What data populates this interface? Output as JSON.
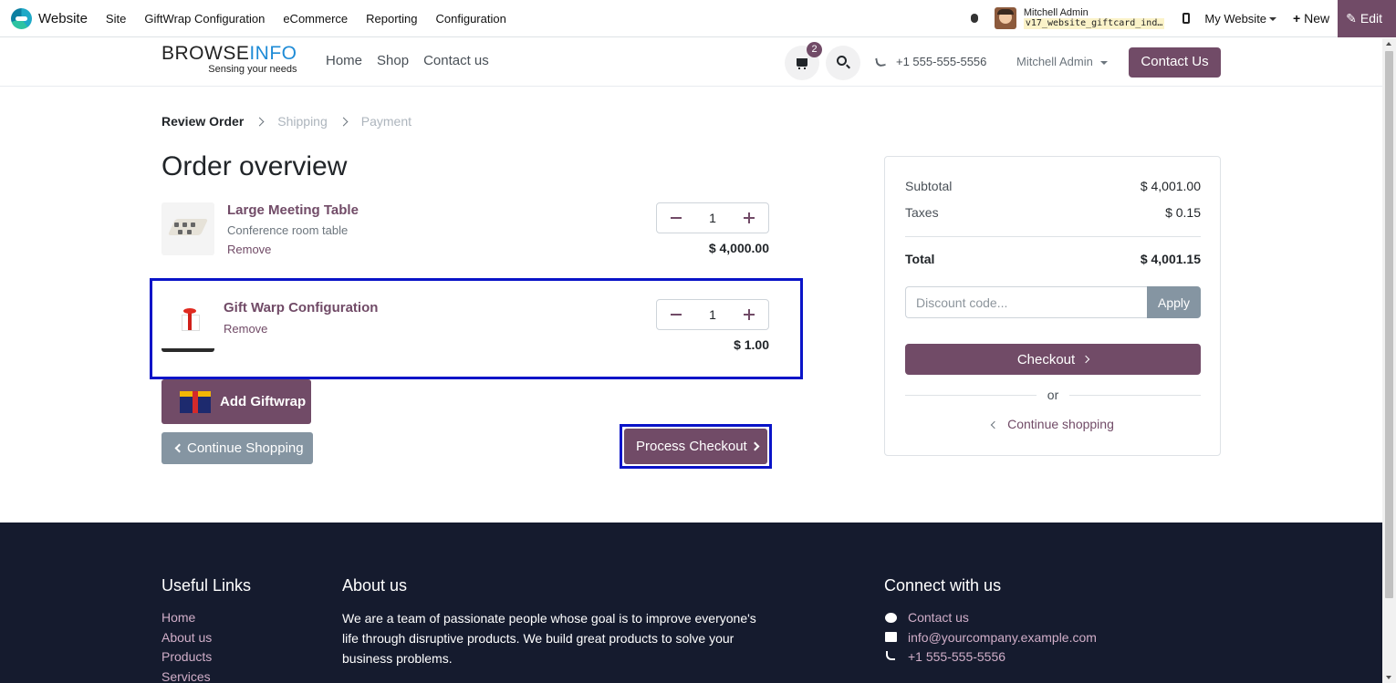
{
  "admin_bar": {
    "app_name": "Website",
    "menu": [
      "Site",
      "GiftWrap Configuration",
      "eCommerce",
      "Reporting",
      "Configuration"
    ],
    "user_name": "Mitchell Admin",
    "database": "v17_website_giftcard_ind…",
    "website_switcher": "My Website",
    "new_label": "New",
    "edit_label": "Edit"
  },
  "site_header": {
    "brand_part1": "BROWSE",
    "brand_part2": "INFO",
    "brand_tagline": "Sensing your needs",
    "nav": [
      "Home",
      "Shop",
      "Contact us"
    ],
    "cart_count": "2",
    "phone": "+1 555-555-5556",
    "user": "Mitchell Admin",
    "contact_button": "Contact Us"
  },
  "steps": {
    "review": "Review Order",
    "shipping": "Shipping",
    "payment": "Payment"
  },
  "page_title": "Order overview",
  "order_lines": [
    {
      "name": "Large Meeting Table",
      "description": "Conference room table",
      "remove": "Remove",
      "quantity": "1",
      "price": "$ 4,000.00"
    },
    {
      "name": "Gift Warp Configuration",
      "remove": "Remove",
      "quantity": "1",
      "price": "$ 1.00"
    }
  ],
  "buttons": {
    "add_giftwrap": "Add Giftwrap",
    "continue_shopping": "Continue Shopping",
    "process_checkout": "Process Checkout"
  },
  "summary": {
    "subtotal_label": "Subtotal",
    "subtotal_value": "$ 4,001.00",
    "taxes_label": "Taxes",
    "taxes_value": "$ 0.15",
    "total_label": "Total",
    "total_value": "$ 4,001.15",
    "discount_placeholder": "Discount code...",
    "apply": "Apply",
    "checkout": "Checkout",
    "or": "or",
    "continue_shopping": "Continue shopping"
  },
  "footer": {
    "useful_links_title": "Useful Links",
    "useful_links": [
      "Home",
      "About us",
      "Products",
      "Services"
    ],
    "about_title": "About us",
    "about_text": "We are a team of passionate people whose goal is to improve everyone's life through disruptive products. We build great products to solve your business problems.",
    "connect_title": "Connect with us",
    "contact_us": "Contact us",
    "email": "info@yourcompany.example.com",
    "phone": "+1 555-555-5556"
  },
  "colors": {
    "brand": "#714b67",
    "highlight": "#0a14c8",
    "footer_bg": "#151b2e",
    "secondary_button": "#8595a2"
  }
}
